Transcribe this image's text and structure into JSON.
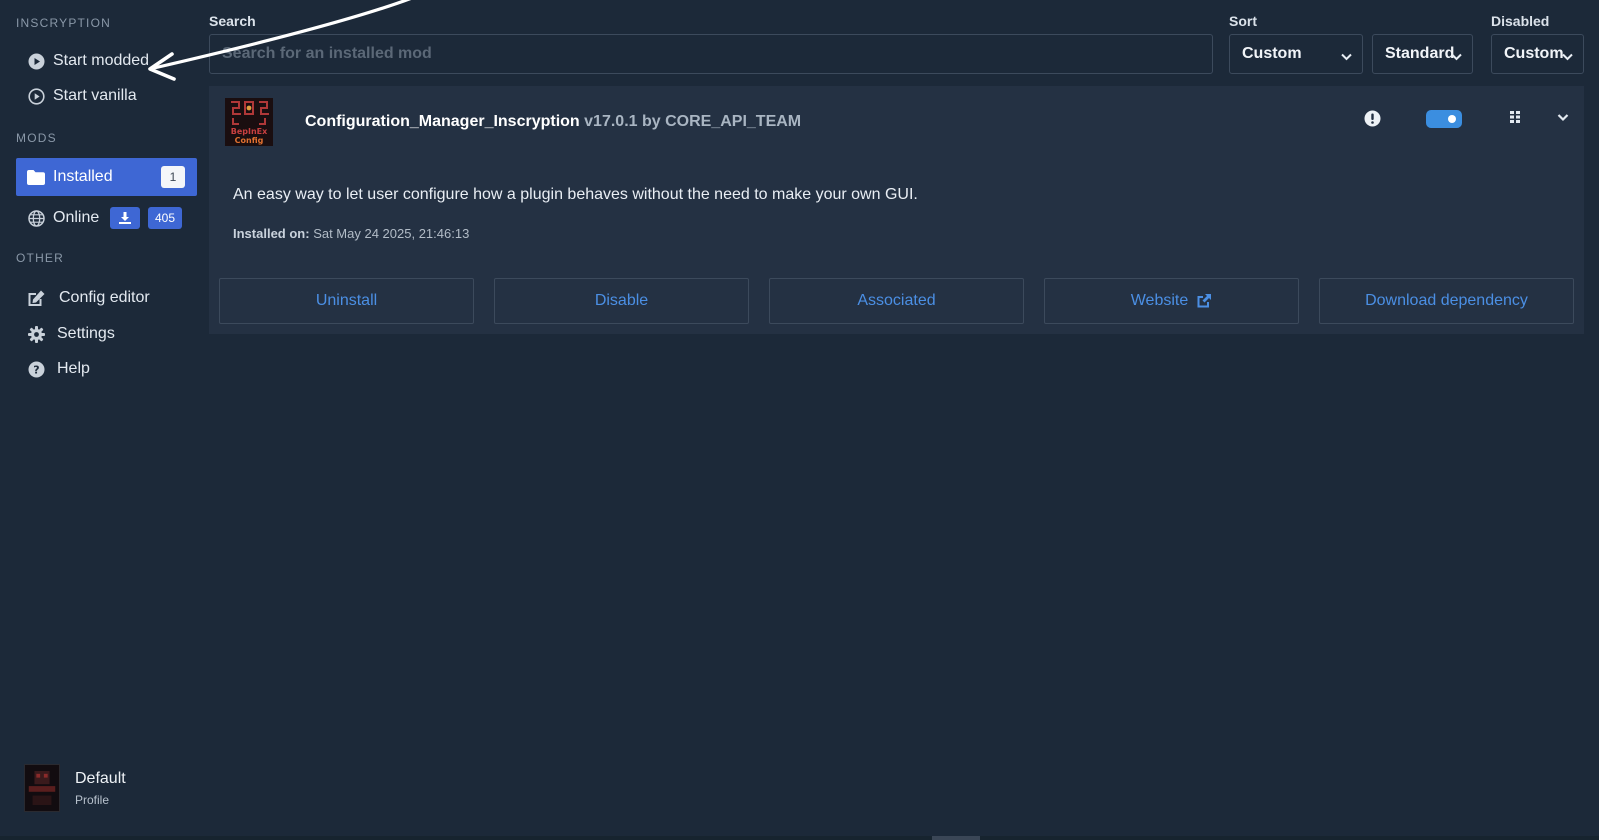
{
  "sidebar": {
    "game_section": "INSCRYPTION",
    "start_modded": "Start modded",
    "start_vanilla": "Start vanilla",
    "mods_section": "MODS",
    "installed": {
      "label": "Installed",
      "count": "1"
    },
    "online": {
      "label": "Online",
      "count": "405"
    },
    "other_section": "OTHER",
    "config_editor": "Config editor",
    "settings": "Settings",
    "help": "Help"
  },
  "profile": {
    "name": "Default",
    "subtitle": "Profile"
  },
  "controls": {
    "search_label": "Search",
    "search_placeholder": "Search for an installed mod",
    "search_value": "",
    "sort_label": "Sort",
    "sort_value": "Custom",
    "order_value": "Standard",
    "disabled_label": "Disabled",
    "disabled_value": "Custom"
  },
  "mod": {
    "name": "Configuration_Manager_Inscryption",
    "version_author": "v17.0.1 by CORE_API_TEAM",
    "enabled": true,
    "description": "An easy way to let user configure how a plugin behaves without the need to make your own GUI.",
    "installed_label": "Installed on:",
    "installed_date": "Sat May 24 2025, 21:46:13",
    "icon_text_top": "BepInEx",
    "icon_text_bottom": "Config",
    "actions": {
      "uninstall": "Uninstall",
      "disable": "Disable",
      "associated": "Associated",
      "website": "Website",
      "download_dependency": "Download dependency"
    }
  },
  "colors": {
    "background": "#1c2939",
    "card": "#243143",
    "accent": "#3e67d4",
    "link": "#4b8fe4"
  }
}
